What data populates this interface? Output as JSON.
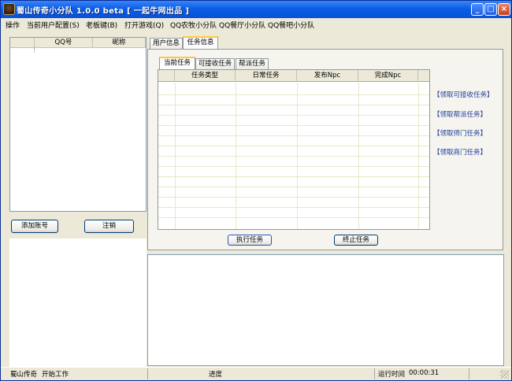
{
  "window": {
    "title": "蜀山传奇小分队 1.0.0 beta [ 一起牛网出品 ]",
    "buttons": {
      "minimize": "_",
      "maximize": "□",
      "close": "×"
    }
  },
  "menu": [
    {
      "label": "操作"
    },
    {
      "label": "当前用户配置(S)"
    },
    {
      "label": "老板键(B)"
    },
    {
      "label": "打开游戏(Q)"
    },
    {
      "label": "QQ农牧小分队"
    },
    {
      "label": "QQ餐厅小分队"
    },
    {
      "label": "QQ餐吧小分队"
    }
  ],
  "account_list": {
    "columns": [
      "QQ号",
      "昵称"
    ],
    "rows": []
  },
  "buttons": {
    "add_account": "添加账号",
    "logout": "注销",
    "execute": "执行任务",
    "stop": "终止任务"
  },
  "outer_tabs": [
    {
      "label": "用户信息",
      "active": false
    },
    {
      "label": "任务信息",
      "active": true
    }
  ],
  "inner_tabs": [
    {
      "label": "当前任务",
      "active": true
    },
    {
      "label": "可接收任务",
      "active": false
    },
    {
      "label": "帮派任务",
      "active": false
    }
  ],
  "task_table": {
    "columns": [
      "任务类型",
      "日常任务",
      "发布Npc",
      "完成Npc"
    ],
    "rows": []
  },
  "side_links": [
    "【领取可接收任务】",
    "【领取帮派任务】",
    "【领取师门任务】",
    "【领取商门任务】"
  ],
  "status": {
    "app": "蜀山传奇",
    "message": "开始工作",
    "progress_label": "进度",
    "runtime_label": "运行时间",
    "runtime_value": "00:00:31"
  },
  "colors": {
    "titlebar": "#0a5ee8",
    "link": "#1d3a9a",
    "tab_highlight": "#ffc83c"
  }
}
